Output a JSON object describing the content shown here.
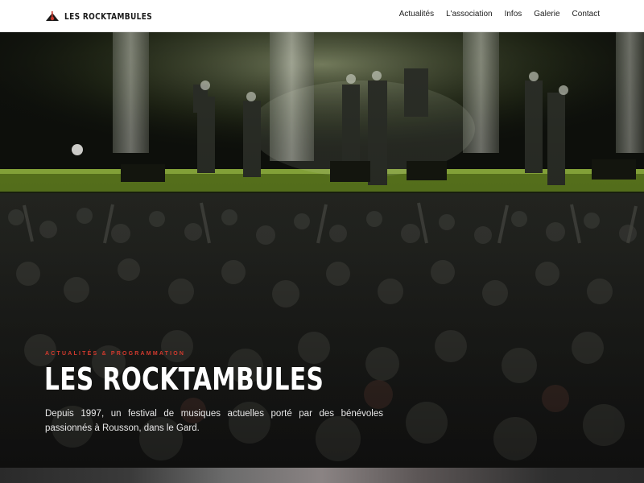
{
  "header": {
    "brand_name": "LES ROCKTAMBULES",
    "logo_icon": "guitar-fest-logo-icon",
    "nav": [
      {
        "label": "Actualités"
      },
      {
        "label": "L'association"
      },
      {
        "label": "Infos"
      },
      {
        "label": "Galerie"
      },
      {
        "label": "Contact"
      }
    ]
  },
  "hero": {
    "kicker": "ACTUALITÉS & PROGRAMMATION",
    "title": "LES ROCKTAMBULES",
    "description": "Depuis 1997, un festival de musiques actuelles porté par des bénévoles passionnés à Rousson, dans le Gard.",
    "image_subject": "concert-stage-crowd-photo"
  },
  "colors": {
    "accent": "#d23a2e",
    "header_bg": "#ffffff",
    "stage_green": "#8fbf3a"
  }
}
